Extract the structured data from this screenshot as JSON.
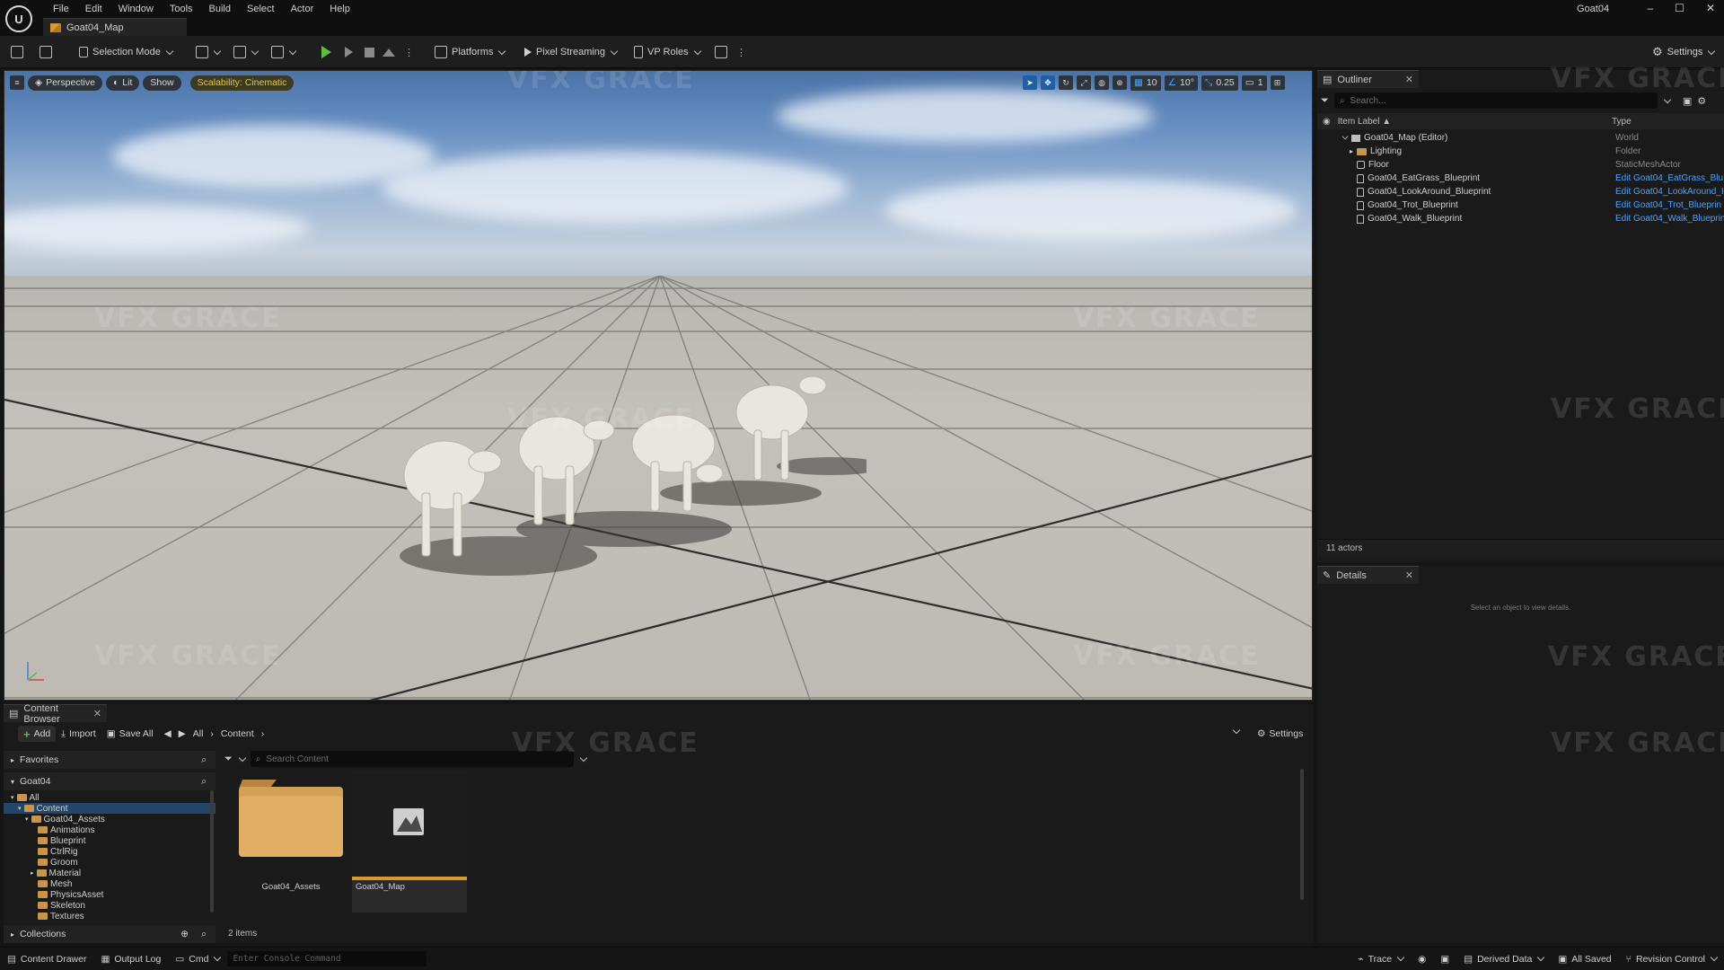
{
  "menu": [
    "File",
    "Edit",
    "Window",
    "Tools",
    "Build",
    "Select",
    "Actor",
    "Help"
  ],
  "doc_tab": "Goat04_Map",
  "window_title": "Goat04",
  "toolbar": {
    "selection_mode": "Selection Mode",
    "platforms": "Platforms",
    "pixel_streaming": "Pixel Streaming",
    "vp_roles": "VP Roles",
    "settings": "Settings"
  },
  "viewport": {
    "perspective": "Perspective",
    "lit": "Lit",
    "show": "Show",
    "scalability": "Scalability: Cinematic",
    "grid_snap": "10",
    "rot_snap": "10°",
    "scale_snap": "0.25",
    "camera_speed": "1"
  },
  "watermark": "VFX GRACE",
  "outliner": {
    "tab": "Outliner",
    "search_placeholder": "Search...",
    "col_label": "Item Label ▲",
    "col_type": "Type",
    "rows": [
      {
        "label": "Goat04_Map (Editor)",
        "type": "World"
      },
      {
        "label": "Lighting",
        "type": "Folder"
      },
      {
        "label": "Floor",
        "type": "StaticMeshActor"
      },
      {
        "label": "Goat04_EatGrass_Blueprint",
        "type": "Edit Goat04_EatGrass_Blu"
      },
      {
        "label": "Goat04_LookAround_Blueprint",
        "type": "Edit Goat04_LookAround_I"
      },
      {
        "label": "Goat04_Trot_Blueprint",
        "type": "Edit Goat04_Trot_Blueprin"
      },
      {
        "label": "Goat04_Walk_Blueprint",
        "type": "Edit Goat04_Walk_Blueprin"
      }
    ],
    "footer": "11 actors"
  },
  "details": {
    "tab": "Details",
    "hint": "Select an object to view details."
  },
  "content_browser": {
    "tab": "Content Browser",
    "add": "Add",
    "import": "Import",
    "save_all": "Save All",
    "crumb_all": "All",
    "crumb_content": "Content",
    "settings": "Settings",
    "favorites": "Favorites",
    "project": "Goat04",
    "search_placeholder": "Search Content",
    "tree": [
      "All",
      "Content",
      "Goat04_Assets",
      "Animations",
      "Blueprint",
      "CtrlRig",
      "Groom",
      "Material",
      "Mesh",
      "PhysicsAsset",
      "Skeleton",
      "Textures"
    ],
    "collections": "Collections",
    "assets": [
      {
        "name": "Goat04_Assets"
      },
      {
        "name": "Goat04_Map"
      }
    ],
    "count": "2 items"
  },
  "statusbar": {
    "content_drawer": "Content Drawer",
    "output_log": "Output Log",
    "cmd": "Cmd",
    "console_placeholder": "Enter Console Command",
    "trace": "Trace",
    "derived_data": "Derived Data",
    "all_saved": "All Saved",
    "revision_control": "Revision Control"
  },
  "colors": {
    "accent_blue": "#1f5fa6",
    "play_green": "#5cbf3d",
    "scalability_yellow": "#e8c64a",
    "link_blue": "#4aa3ff"
  }
}
